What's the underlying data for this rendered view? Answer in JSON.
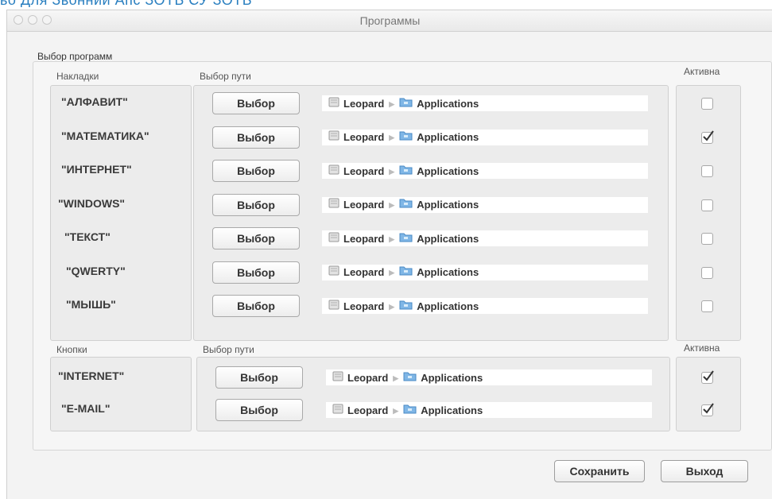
{
  "header_fragment": "ьо Для Звонний Апс ЗОТЬ СУ ЗОТЬ",
  "window": {
    "title": "Программы"
  },
  "group_label": "Выбор программ",
  "overlays": {
    "col_names": "Накладки",
    "col_path": "Выбор пути",
    "col_active": "Активна",
    "rows": [
      {
        "name": "\"АЛФАВИТ\"",
        "button": "Выбор",
        "volume": "Leopard",
        "folder": "Applications",
        "active": false
      },
      {
        "name": "\"МАТЕМАТИКА\"",
        "button": "Выбор",
        "volume": "Leopard",
        "folder": "Applications",
        "active": true
      },
      {
        "name": "\"ИНТЕРНЕТ\"",
        "button": "Выбор",
        "volume": "Leopard",
        "folder": "Applications",
        "active": false
      },
      {
        "name": "\"WINDOWS\"",
        "button": "Выбор",
        "volume": "Leopard",
        "folder": "Applications",
        "active": false
      },
      {
        "name": "\"ТЕКСТ\"",
        "button": "Выбор",
        "volume": "Leopard",
        "folder": "Applications",
        "active": false
      },
      {
        "name": "\"QWERTY\"",
        "button": "Выбор",
        "volume": "Leopard",
        "folder": "Applications",
        "active": false
      },
      {
        "name": "\"МЫШЬ\"",
        "button": "Выбор",
        "volume": "Leopard",
        "folder": "Applications",
        "active": false
      }
    ]
  },
  "buttons_section": {
    "col_names": "Кнопки",
    "col_path": "Выбор пути",
    "col_active": "Активна",
    "rows": [
      {
        "name": "\"INTERNET\"",
        "button": "Выбор",
        "volume": "Leopard",
        "folder": "Applications",
        "active": true
      },
      {
        "name": "\"E-MAIL\"",
        "button": "Выбор",
        "volume": "Leopard",
        "folder": "Applications",
        "active": true
      }
    ]
  },
  "footer": {
    "save": "Сохранить",
    "exit": "Выход"
  },
  "icons": {
    "volume": "disk-icon",
    "folder": "folder-icon",
    "separator": "path-arrow-icon",
    "check": "checkmark-icon"
  }
}
